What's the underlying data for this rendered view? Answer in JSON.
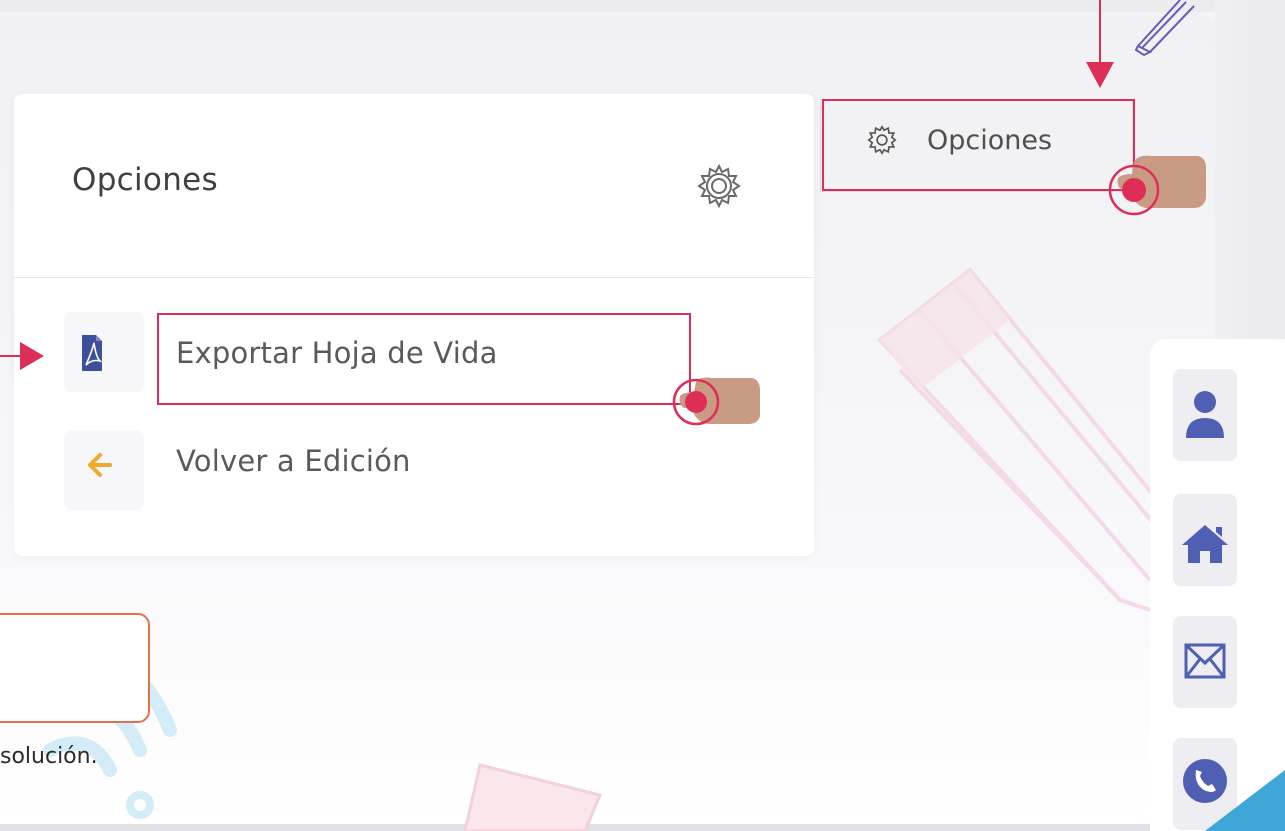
{
  "options_card": {
    "title": "Opciones",
    "menu": [
      {
        "label": "Exportar Hoja de Vida",
        "icon": "pdf-file-icon"
      },
      {
        "label": "Volver a Edición",
        "icon": "arrow-left-icon"
      }
    ]
  },
  "top_button": {
    "label": "Opciones",
    "icon": "gear-icon"
  },
  "side_nav": [
    {
      "icon": "user-icon"
    },
    {
      "icon": "home-icon"
    },
    {
      "icon": "mail-icon"
    },
    {
      "icon": "phone-icon"
    }
  ],
  "tip": {
    "text": "solución."
  },
  "colors": {
    "annotation_red": "#dd2e57",
    "pdf_blue": "#3e4f9b",
    "back_arrow": "#f0a92a",
    "side_icon": "#4f5fb3",
    "tip_border": "#e2704b",
    "hand": "#c99a84"
  }
}
